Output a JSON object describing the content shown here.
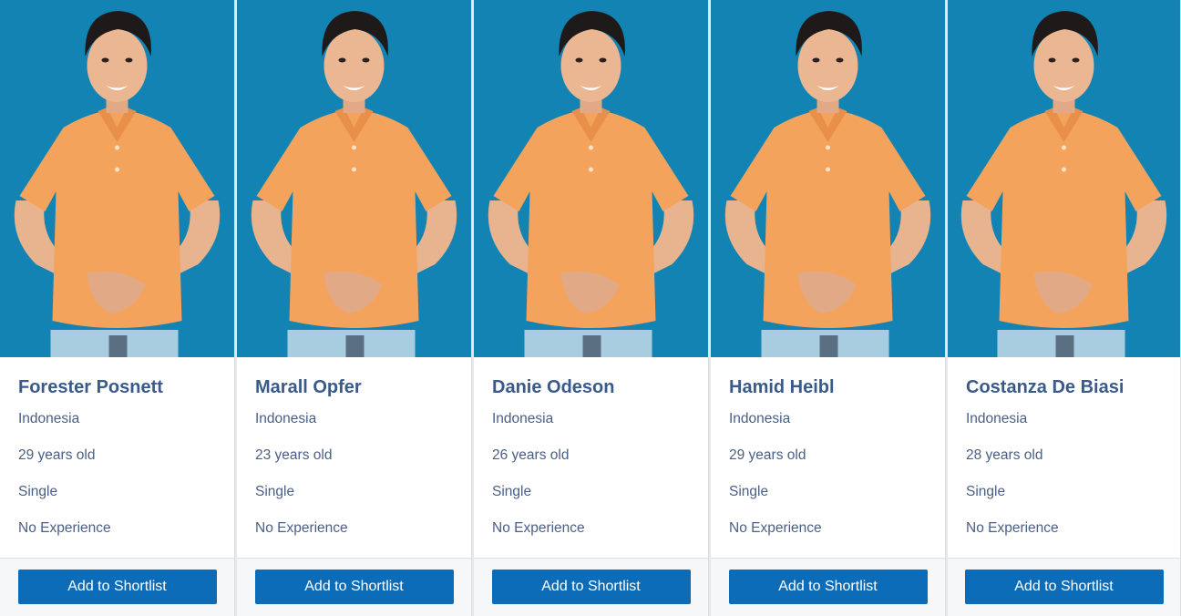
{
  "colors": {
    "photo_background": "#1283b3",
    "name_text": "#3a5a8c",
    "detail_text": "#4a5f86",
    "button": "#0d6cb8",
    "shirt": "#f4a35c"
  },
  "button_label": "Add to Shortlist",
  "candidates": [
    {
      "name": "Forester Posnett",
      "country": "Indonesia",
      "age": "29 years old",
      "status": "Single",
      "experience": "No Experience"
    },
    {
      "name": "Marall Opfer",
      "country": "Indonesia",
      "age": "23 years old",
      "status": "Single",
      "experience": "No Experience"
    },
    {
      "name": "Danie Odeson",
      "country": "Indonesia",
      "age": "26 years old",
      "status": "Single",
      "experience": "No Experience"
    },
    {
      "name": "Hamid Heibl",
      "country": "Indonesia",
      "age": "29 years old",
      "status": "Single",
      "experience": "No Experience"
    },
    {
      "name": "Costanza De Biasi",
      "country": "Indonesia",
      "age": "28 years old",
      "status": "Single",
      "experience": "No Experience"
    }
  ]
}
